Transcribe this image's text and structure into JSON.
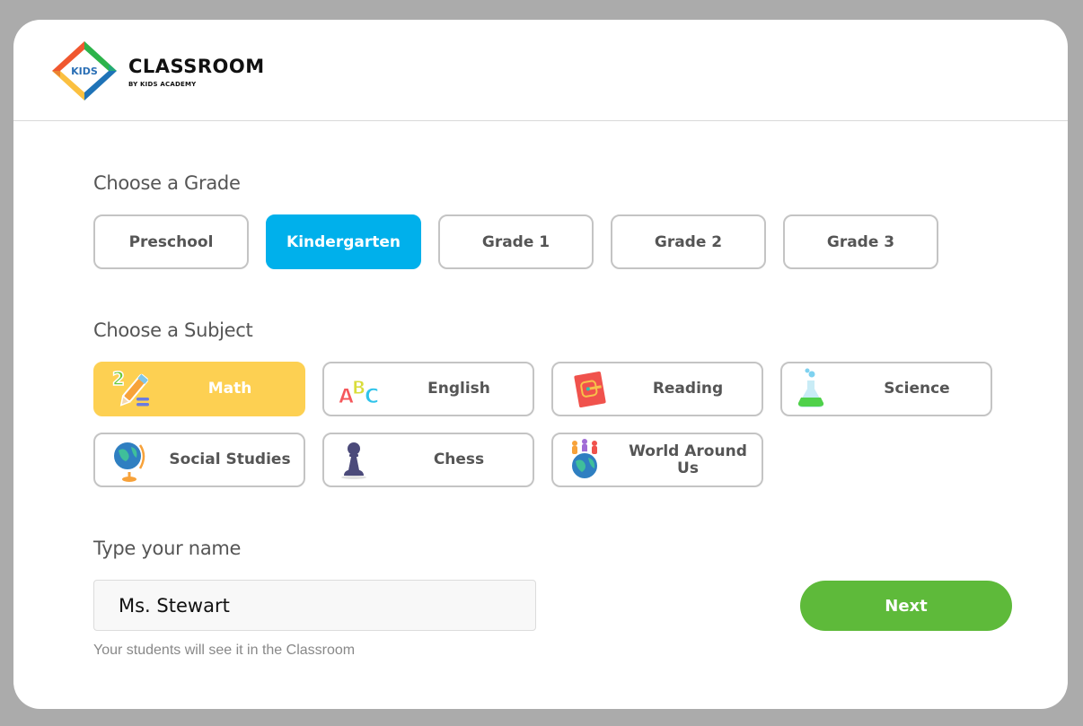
{
  "brand": {
    "title": "CLASSROOM",
    "subtitle": "BY KIDS ACADEMY",
    "logo_badge": "KIDS"
  },
  "grade_section": {
    "label": "Choose a Grade",
    "options": [
      {
        "label": "Preschool",
        "selected": false
      },
      {
        "label": "Kindergarten",
        "selected": true
      },
      {
        "label": "Grade 1",
        "selected": false
      },
      {
        "label": "Grade 2",
        "selected": false
      },
      {
        "label": "Grade 3",
        "selected": false
      }
    ]
  },
  "subject_section": {
    "label": "Choose a Subject",
    "options": [
      {
        "label": "Math",
        "icon": "pencil-numbers-icon",
        "selected": true
      },
      {
        "label": "English",
        "icon": "abc-letters-icon",
        "selected": false
      },
      {
        "label": "Reading",
        "icon": "book-icon",
        "selected": false
      },
      {
        "label": "Science",
        "icon": "flask-icon",
        "selected": false
      },
      {
        "label": "Social Studies",
        "icon": "globe-icon",
        "selected": false
      },
      {
        "label": "Chess",
        "icon": "chess-pawn-icon",
        "selected": false
      },
      {
        "label": "World Around Us",
        "icon": "world-people-icon",
        "selected": false
      }
    ]
  },
  "name_section": {
    "label": "Type your name",
    "value": "Ms. Stewart",
    "hint": "Your students will see it in the Classroom"
  },
  "actions": {
    "next_label": "Next"
  },
  "colors": {
    "grade_selected": "#00b0eb",
    "subject_selected": "#fdd052",
    "next_button": "#5eba3a"
  }
}
